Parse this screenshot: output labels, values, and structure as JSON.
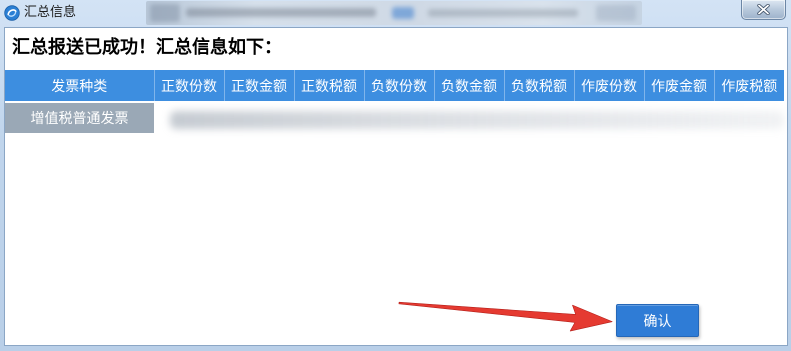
{
  "window": {
    "title": "汇总信息",
    "app_icon": "app-logo-icon",
    "close_icon": "close-icon"
  },
  "message": "汇总报送已成功！汇总信息如下：",
  "table": {
    "columns": [
      "发票种类",
      "正数份数",
      "正数金额",
      "正数税额",
      "负数份数",
      "负数金额",
      "负数税额",
      "作废份数",
      "作废金额",
      "作废税额"
    ],
    "rows": [
      {
        "invoice_type": "增值税普通发票"
      }
    ]
  },
  "buttons": {
    "confirm": "确认"
  },
  "colors": {
    "header_bg": "#3d8ee0",
    "row_label_bg": "#9aa8b6",
    "confirm_bg": "#2f7cd6",
    "annotation_arrow": "#e53a31"
  }
}
